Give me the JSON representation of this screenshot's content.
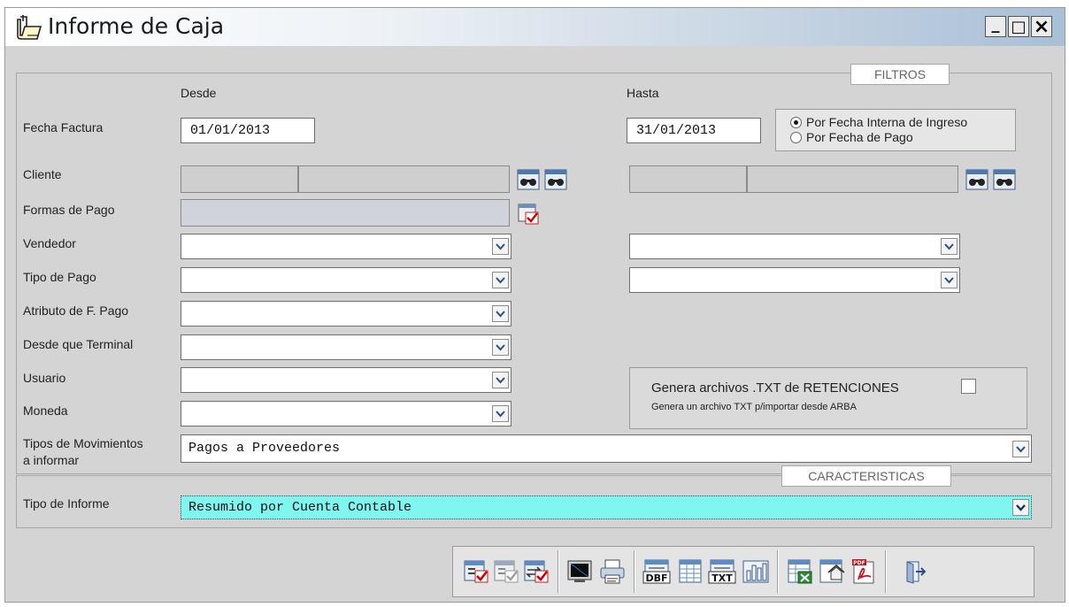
{
  "window": {
    "title": "Informe de Caja",
    "minimize": "_",
    "maximize": "□",
    "close": "×",
    "icon": "folder-form-icon"
  },
  "filtros": {
    "legend": "FILTROS",
    "desde_label": "Desde",
    "hasta_label": "Hasta",
    "fecha_factura_label": "Fecha Factura",
    "fecha_desde": "01/01/2013",
    "fecha_hasta": "31/01/2013",
    "radio_options": [
      {
        "label": "Por Fecha Interna de Ingreso",
        "selected": true
      },
      {
        "label": "Por Fecha de Pago",
        "selected": false
      }
    ],
    "cliente_label": "Cliente",
    "formas_pago_label": "Formas de Pago",
    "vendedor_label": "Vendedor",
    "tipo_pago_label": "Tipo de Pago",
    "atributo_label": "Atributo de F. Pago",
    "terminal_label": "Desde que Terminal",
    "usuario_label": "Usuario",
    "moneda_label": "Moneda",
    "tipos_mov_label_1": "Tipos de Movimientos",
    "tipos_mov_label_2": "a informar",
    "tipos_mov_value": "Pagos a Proveedores",
    "retenciones_title": "Genera archivos .TXT de RETENCIONES",
    "retenciones_sub": "Genera un archivo TXT p/importar desde ARBA",
    "retenciones_checked": false
  },
  "caracteristicas": {
    "legend": "CARACTERISTICAS",
    "tipo_informe_label": "Tipo de Informe",
    "tipo_informe_value": "Resumido por Cuenta Contable",
    "highlight_color": "#7ff7f0"
  },
  "toolbar": {
    "buttons": [
      "select-all-icon",
      "select-none-icon",
      "invert-selection-icon",
      "preview-screen-icon",
      "print-icon",
      "export-dbf-icon",
      "export-table-icon",
      "export-txt-icon",
      "chart-icon",
      "export-excel-icon",
      "export-html-icon",
      "export-pdf-icon",
      "exit-icon"
    ],
    "dbf_text": "DBF",
    "txt_text": "TXT",
    "pdf_text": "PDF"
  }
}
